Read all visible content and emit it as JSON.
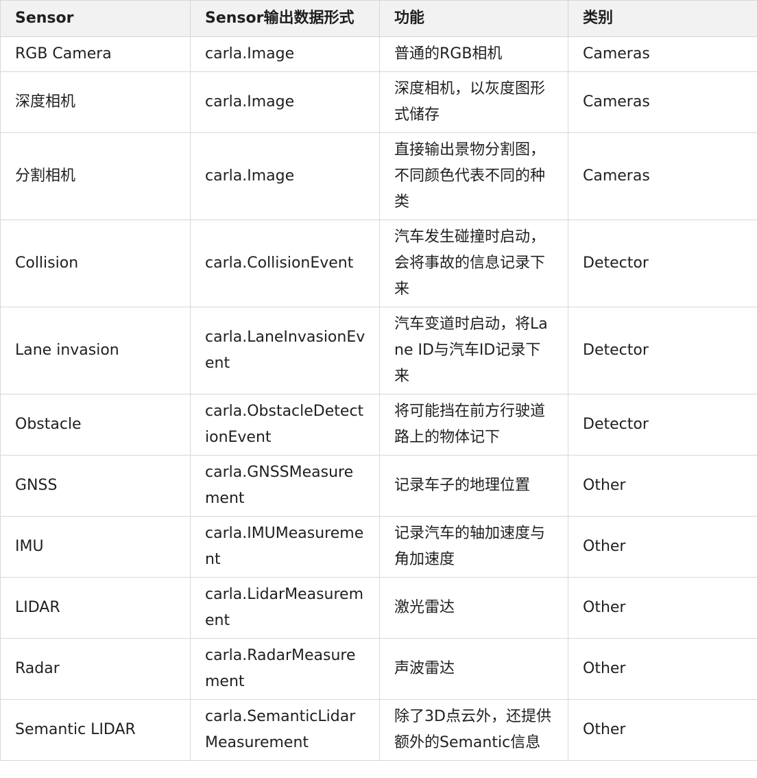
{
  "table": {
    "headers": [
      "Sensor",
      "Sensor输出数据形式",
      "功能",
      "类别"
    ],
    "rows": [
      [
        "RGB Camera",
        "carla.Image",
        "普通的RGB相机",
        "Cameras"
      ],
      [
        "深度相机",
        "carla.Image",
        "深度相机，以灰度图形式储存",
        "Cameras"
      ],
      [
        "分割相机",
        "carla.Image",
        "直接输出景物分割图，不同颜色代表不同的种类",
        "Cameras"
      ],
      [
        "Collision",
        "carla.CollisionEvent",
        "汽车发生碰撞时启动，会将事故的信息记录下来",
        "Detector"
      ],
      [
        "Lane invasion",
        "carla.LaneInvasionEvent",
        "汽车变道时启动，将Lane ID与汽车ID记录下来",
        "Detector"
      ],
      [
        "Obstacle",
        "carla.ObstacleDetectionEvent",
        "将可能挡在前方行驶道路上的物体记下",
        "Detector"
      ],
      [
        "GNSS",
        "carla.GNSSMeasurement",
        "记录车子的地理位置",
        "Other"
      ],
      [
        "IMU",
        "carla.IMUMeasurement",
        "记录汽车的轴加速度与角加速度",
        "Other"
      ],
      [
        "LIDAR",
        "carla.LidarMeasurement",
        "激光雷达",
        "Other"
      ],
      [
        "Radar",
        "carla.RadarMeasurement",
        "声波雷达",
        "Other"
      ],
      [
        "Semantic LIDAR",
        "carla.SemanticLidarMeasurement",
        "除了3D点云外，还提供额外的Semantic信息",
        "Other"
      ]
    ]
  }
}
